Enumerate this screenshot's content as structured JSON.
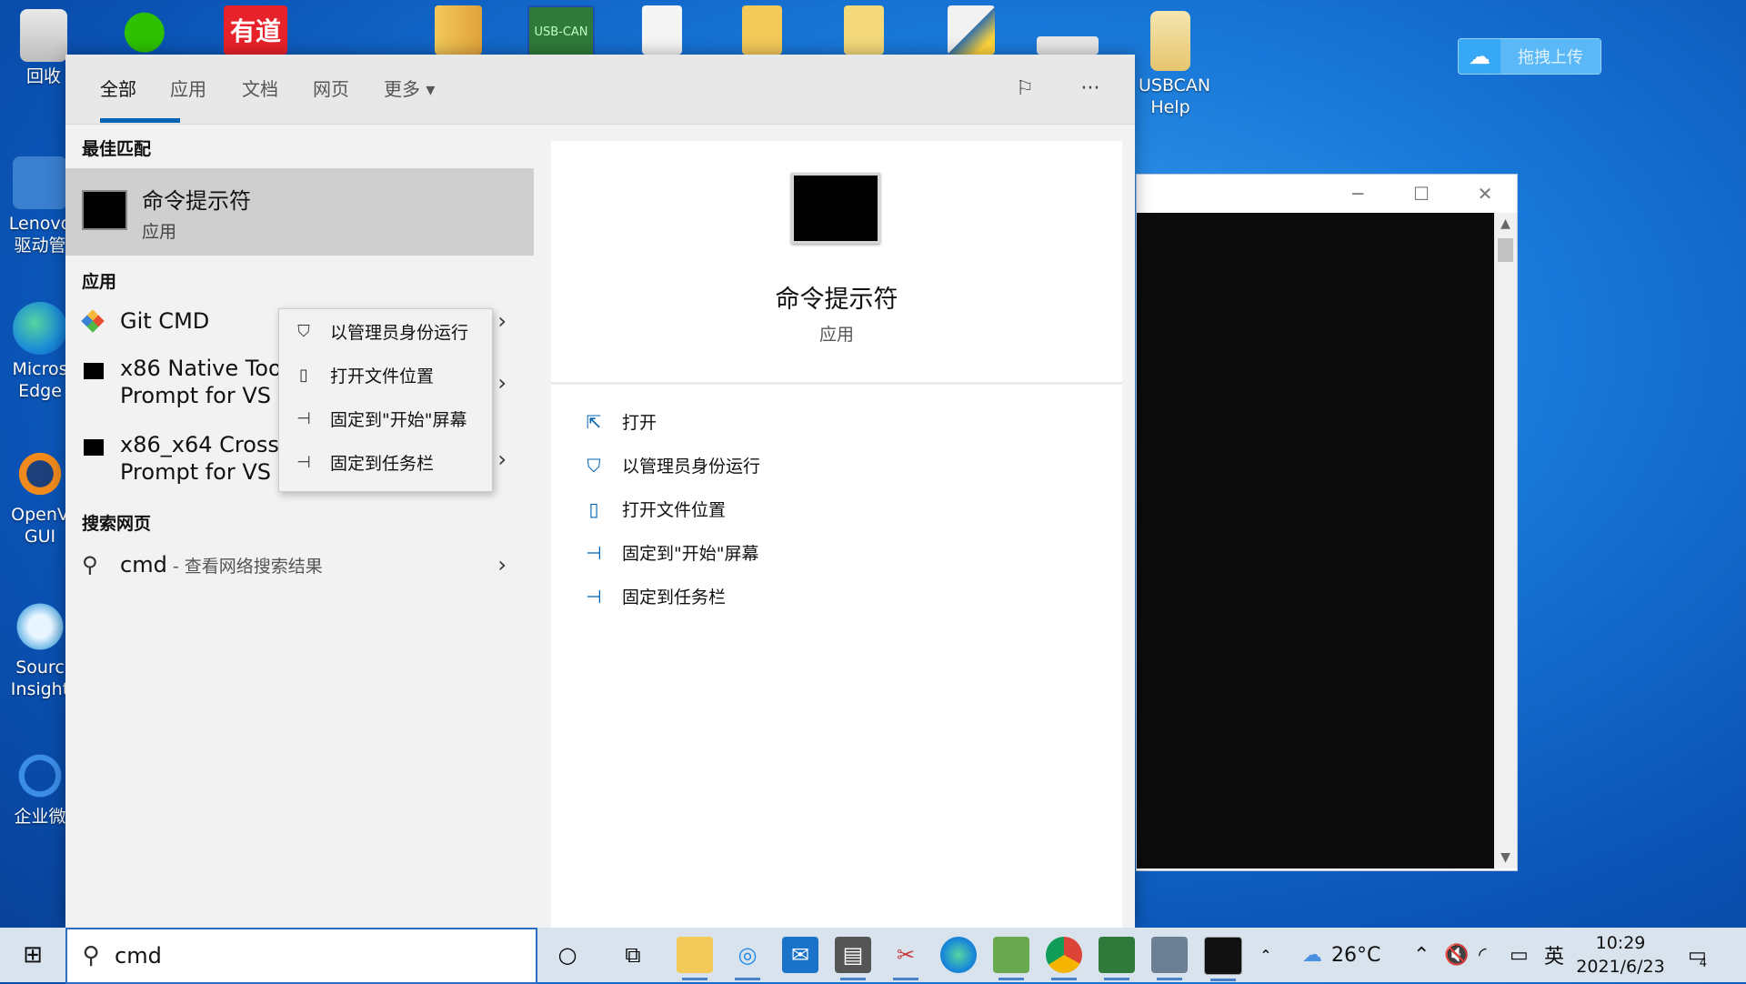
{
  "desktop": {
    "icons_left": [
      {
        "label": "回收",
        "color": "#d9d9d9"
      },
      {
        "label": "Lenovo 驱动管",
        "color": "#3a7fd0"
      },
      {
        "label": "Micros Edge",
        "color": "#1aa0d8"
      },
      {
        "label": "OpenV GUI",
        "color": "#f08a1c"
      },
      {
        "label": "Sourc Insight",
        "color": "#6fb8e8"
      },
      {
        "label": "企业微",
        "color": "#3c8de8"
      }
    ],
    "usbcan_help_label": "USBCAN Help",
    "baidu_upload_label": "拖拽上传",
    "top_icons": [
      {
        "name": "wechat-icon",
        "glyph": "●",
        "color": "#2dc100"
      },
      {
        "name": "youdao-icon",
        "glyph": "有道",
        "color": "#e8222a"
      },
      {
        "name": "folder-icon",
        "glyph": "",
        "color": "#f3c95a"
      },
      {
        "name": "usbcan-icon",
        "glyph": "USB-CAN",
        "color": "#2f7a3a"
      },
      {
        "name": "file-icon",
        "glyph": "",
        "color": "#f5f5f5"
      },
      {
        "name": "folder-icon-2",
        "glyph": "",
        "color": "#f3c95a"
      },
      {
        "name": "folder-icon-3",
        "glyph": "",
        "color": "#f3d97a"
      },
      {
        "name": "python-icon",
        "glyph": "",
        "color": "#f2f2f2"
      },
      {
        "name": "app-shortcut-icon",
        "glyph": "",
        "color": "#e7e7e7"
      },
      {
        "name": "usbcan-help-icon",
        "glyph": "",
        "color": "#f5e6b0"
      }
    ]
  },
  "search_panel": {
    "tabs": [
      "全部",
      "应用",
      "文档",
      "网页",
      "更多"
    ],
    "active_tab": "全部",
    "more_chevron": "▾",
    "best_match": {
      "section_title": "最佳匹配",
      "name": "命令提示符",
      "type": "应用"
    },
    "apps": {
      "section_title": "应用",
      "items": [
        {
          "name": "Git CMD"
        },
        {
          "name": "x86 Native Tools Command Prompt for VS 2019"
        },
        {
          "name": "x86_x64 Cross Tools Command Prompt for VS 2019"
        }
      ],
      "item1_line1": "x86 Native Tools",
      "item1_line2": "Prompt for VS 2",
      "item2_line1": "x86_x64 Cross Tools Command",
      "item2_line2": "Prompt for VS 2019"
    },
    "web": {
      "section_title": "搜索网页",
      "query": "cmd",
      "suffix": " - 查看网络搜索结果"
    },
    "context_menu": [
      {
        "label": "以管理员身份运行",
        "icon": "shield-icon"
      },
      {
        "label": "打开文件位置",
        "icon": "file-location-icon"
      },
      {
        "label": "固定到\"开始\"屏幕",
        "icon": "pin-icon"
      },
      {
        "label": "固定到任务栏",
        "icon": "pin-icon"
      }
    ],
    "preview": {
      "name": "命令提示符",
      "type": "应用",
      "actions": [
        {
          "label": "打开",
          "icon": "open-icon"
        },
        {
          "label": "以管理员身份运行",
          "icon": "shield-icon"
        },
        {
          "label": "打开文件位置",
          "icon": "file-location-icon"
        },
        {
          "label": "固定到\"开始\"屏幕",
          "icon": "pin-icon"
        },
        {
          "label": "固定到任务栏",
          "icon": "pin-icon"
        }
      ]
    }
  },
  "taskbar": {
    "search_value": "cmd",
    "weather": "26°C",
    "ime": "英",
    "time": "10:29",
    "date": "2021/6/23",
    "notification_count": "4"
  }
}
